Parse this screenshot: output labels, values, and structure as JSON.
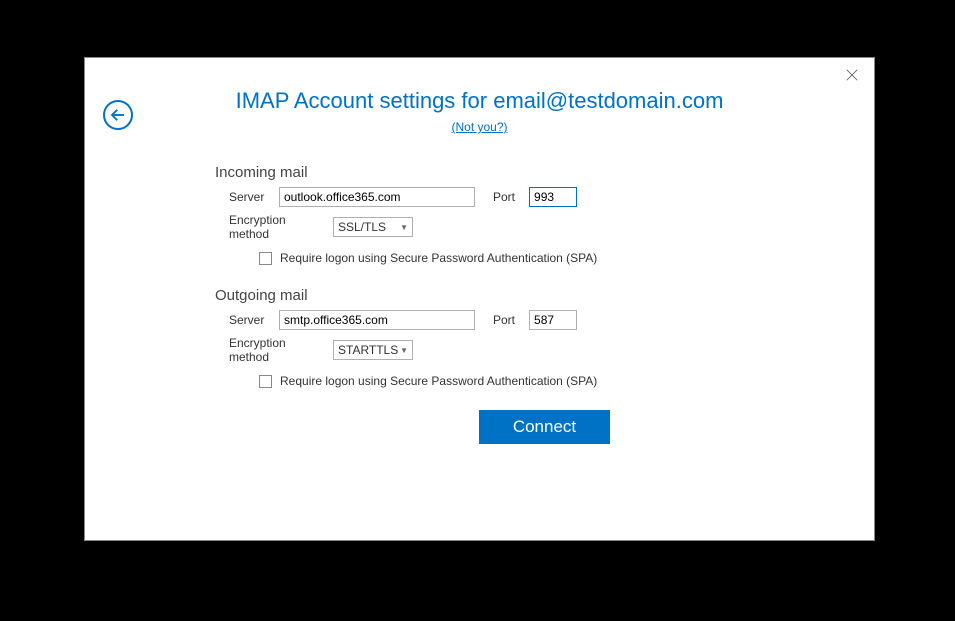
{
  "header": {
    "title": "IMAP Account settings for email@testdomain.com",
    "not_you": "(Not you?)"
  },
  "incoming": {
    "section_title": "Incoming mail",
    "server_label": "Server",
    "server_value": "outlook.office365.com",
    "port_label": "Port",
    "port_value": "993",
    "enc_label": "Encryption method",
    "enc_value": "SSL/TLS",
    "spa_label": "Require logon using Secure Password Authentication (SPA)",
    "spa_checked": false
  },
  "outgoing": {
    "section_title": "Outgoing mail",
    "server_label": "Server",
    "server_value": "smtp.office365.com",
    "port_label": "Port",
    "port_value": "587",
    "enc_label": "Encryption method",
    "enc_value": "STARTTLS",
    "spa_label": "Require logon using Secure Password Authentication (SPA)",
    "spa_checked": false
  },
  "connect_label": "Connect"
}
